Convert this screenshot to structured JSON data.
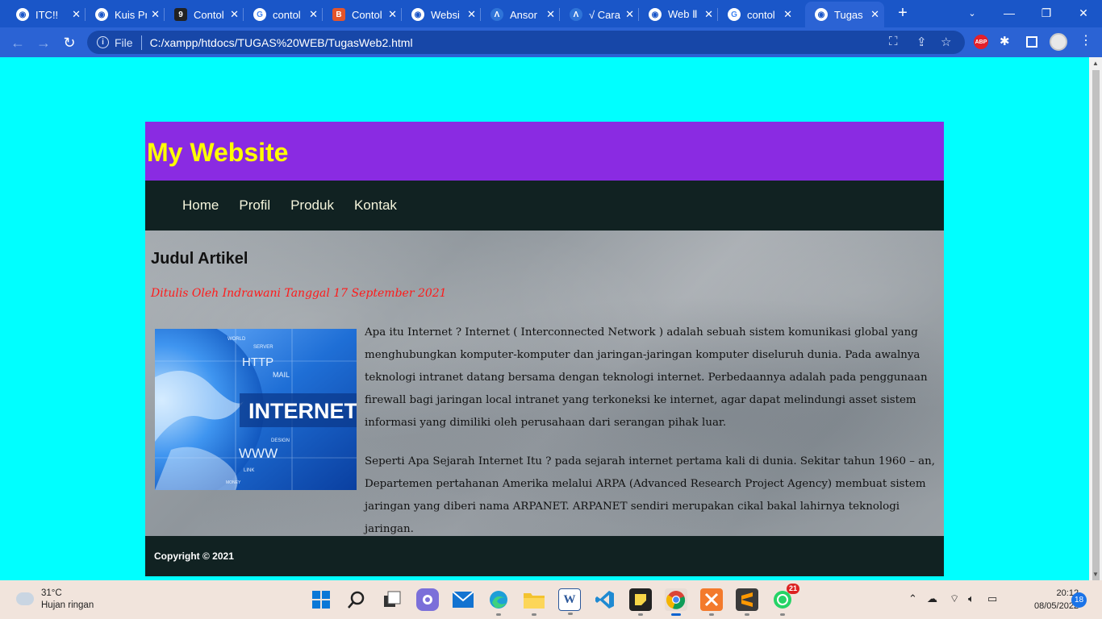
{
  "browser": {
    "tabs": [
      {
        "label": "ITC!!",
        "icon": "globe-icon",
        "color": "#1a56c8"
      },
      {
        "label": "Kuis Pr",
        "icon": "globe-icon",
        "color": "#1a56c8"
      },
      {
        "label": "Contol",
        "icon": "g9-icon",
        "color": "#222222"
      },
      {
        "label": "contol",
        "icon": "google-icon",
        "color": "#ffffff"
      },
      {
        "label": "Contol",
        "icon": "blogger-icon",
        "color": "#e4552b"
      },
      {
        "label": "Websi",
        "icon": "globe-icon",
        "color": "#1a56c8"
      },
      {
        "label": "Ansor",
        "icon": "scribd-icon",
        "color": "#2f74d8"
      },
      {
        "label": "√ Cara",
        "icon": "scribd-icon",
        "color": "#2f74d8"
      },
      {
        "label": "Web Ⅱ",
        "icon": "globe-icon",
        "color": "#1a56c8"
      },
      {
        "label": "contol",
        "icon": "google-icon",
        "color": "#ffffff"
      },
      {
        "label": "Tugas",
        "icon": "globe-icon",
        "color": "#1a56c8",
        "active": true
      }
    ],
    "scheme": "File",
    "url": "C:/xampp/htdocs/TUGAS%20WEB/TugasWeb2.html"
  },
  "site": {
    "title": "My Website",
    "nav": [
      "Home",
      "Profil",
      "Produk",
      "Kontak"
    ],
    "article": {
      "heading": "Judul Artikel",
      "byline": "Ditulis Oleh Indrawani Tanggal 17 September 2021",
      "image_text": {
        "main": "INTERNET",
        "http": "HTTP",
        "mail": "MAIL",
        "www": "WWW",
        "world": "WORLD",
        "server": "SERVER",
        "design": "DESIGN",
        "link": "LINK",
        "money": "MONEY"
      },
      "paragraphs": [
        "Apa itu Internet ? Internet ( Interconnected Network ) adalah sebuah sistem komunikasi global yang menghubungkan komputer-komputer dan jaringan-jaringan komputer diseluruh dunia. Pada awalnya teknologi intranet datang bersama dengan teknologi internet. Perbedaannya adalah pada penggunaan firewall bagi jaringan local intranet yang terkoneksi ke internet, agar dapat melindungi asset sistem informasi yang dimiliki oleh perusahaan dari serangan pihak luar.",
        "Seperti Apa Sejarah Internet Itu ? pada sejarah internet pertama kali di dunia. Sekitar tahun 1960 – an, Departemen pertahanan Amerika melalui ARPA (Advanced Research Project Agency) membuat sistem jaringan yang diberi nama ARPANET. ARPANET sendiri merupakan cikal bakal lahirnya teknologi jaringan."
      ]
    },
    "footer": "Copyright © 2021",
    "colors": {
      "page_bg": "#00ffff",
      "header_bg": "#8a2be2",
      "title": "#ffff00",
      "nav_bg": "#112222",
      "byline": "#ff1a1a"
    }
  },
  "taskbar": {
    "weather": {
      "temp": "31°C",
      "desc": "Hujan ringan"
    },
    "apps": [
      {
        "name": "windows-start-icon"
      },
      {
        "name": "search-icon"
      },
      {
        "name": "task-view-icon"
      },
      {
        "name": "teams-chat-icon"
      },
      {
        "name": "mail-icon"
      },
      {
        "name": "edge-icon"
      },
      {
        "name": "file-explorer-icon"
      },
      {
        "name": "word-icon",
        "glyph": "W"
      },
      {
        "name": "vscode-icon"
      },
      {
        "name": "sticky-notes-icon"
      },
      {
        "name": "chrome-icon"
      },
      {
        "name": "xampp-icon"
      },
      {
        "name": "sublime-text-icon"
      },
      {
        "name": "whatsapp-icon",
        "badge": "21"
      }
    ],
    "time": "20:12",
    "date": "08/05/2022",
    "notifications": "18"
  }
}
